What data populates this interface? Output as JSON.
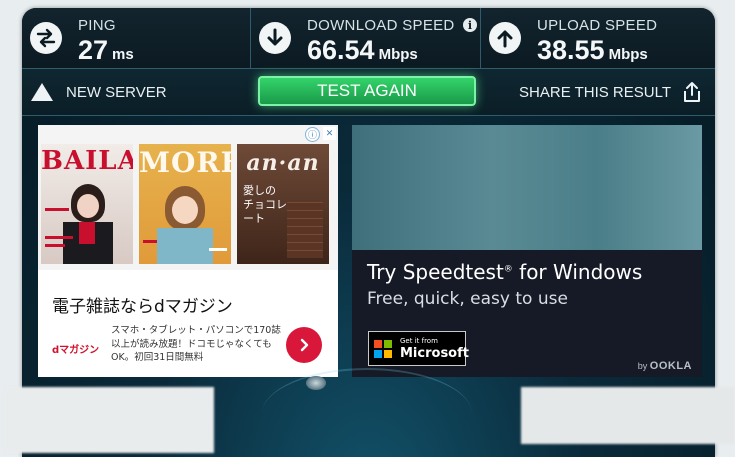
{
  "stats": {
    "ping": {
      "label": "PING",
      "value": "27",
      "unit": "ms",
      "icon": "ping-arrows-icon"
    },
    "download": {
      "label": "DOWNLOAD SPEED",
      "value": "66.54",
      "unit": "Mbps",
      "icon": "download-arrow-icon",
      "info": "i"
    },
    "upload": {
      "label": "UPLOAD SPEED",
      "value": "38.55",
      "unit": "Mbps",
      "icon": "upload-arrow-icon"
    }
  },
  "actions": {
    "new_server": "NEW SERVER",
    "test_again": "TEST AGAIN",
    "share": "SHARE THIS RESULT"
  },
  "ad_left": {
    "magazines": [
      "BAILA",
      "MORE",
      "an·an"
    ],
    "cover_text": "愛しの\nチョコレート",
    "headline": "電子雑誌ならdマガジン",
    "brand": "dマガジン",
    "body": "スマホ・タブレット・パソコンで170誌以上が読み放題！ドコモじゃなくてもOK。初回31日間無料",
    "badge_info": "ⓘ",
    "badge_close": "✕"
  },
  "ad_right": {
    "title": "Try Speedtest",
    "title_mark": "®",
    "title_suffix": " for Windows",
    "subtitle": "Free, quick, easy to use",
    "store_small": "Get it from",
    "store_big": "Microsoft",
    "by": "by",
    "ookla": "OOKLA"
  },
  "colors": {
    "accent_green": "#2fc563",
    "panel_dark": "#0c1a22",
    "ad_cta_red": "#d9173a"
  }
}
